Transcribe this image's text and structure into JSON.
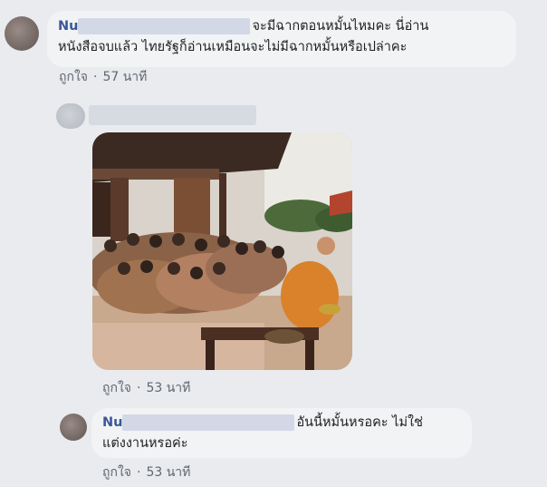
{
  "colors": {
    "background": "#e9ebee",
    "bubble": "#f2f3f5",
    "author": "#385898",
    "meta": "#606770",
    "robe": "#d9822b"
  },
  "comments": [
    {
      "author_visible": "Nu",
      "text_line1": "จะมีฉากตอนหมั้นไหมคะ นี่อ่าน",
      "text_line2": "หนังสือจบแล้ว ไทยรัฐก็อ่านเหมือนจะไม่มีฉากหมั้นหรือเปล่าคะ",
      "like_label": "ถูกใจ",
      "timestamp": "57 นาที"
    },
    {
      "author_visible": "",
      "photo_alt": "photo",
      "like_label": "ถูกใจ",
      "timestamp": "53 นาที"
    },
    {
      "author_visible": "Nu",
      "text_line1": "อันนี้หมั้นหรอคะ ไม่ใช่",
      "text_line2": "แต่งงานหรอค่ะ",
      "like_label": "ถูกใจ",
      "timestamp": "53 นาที"
    }
  ]
}
